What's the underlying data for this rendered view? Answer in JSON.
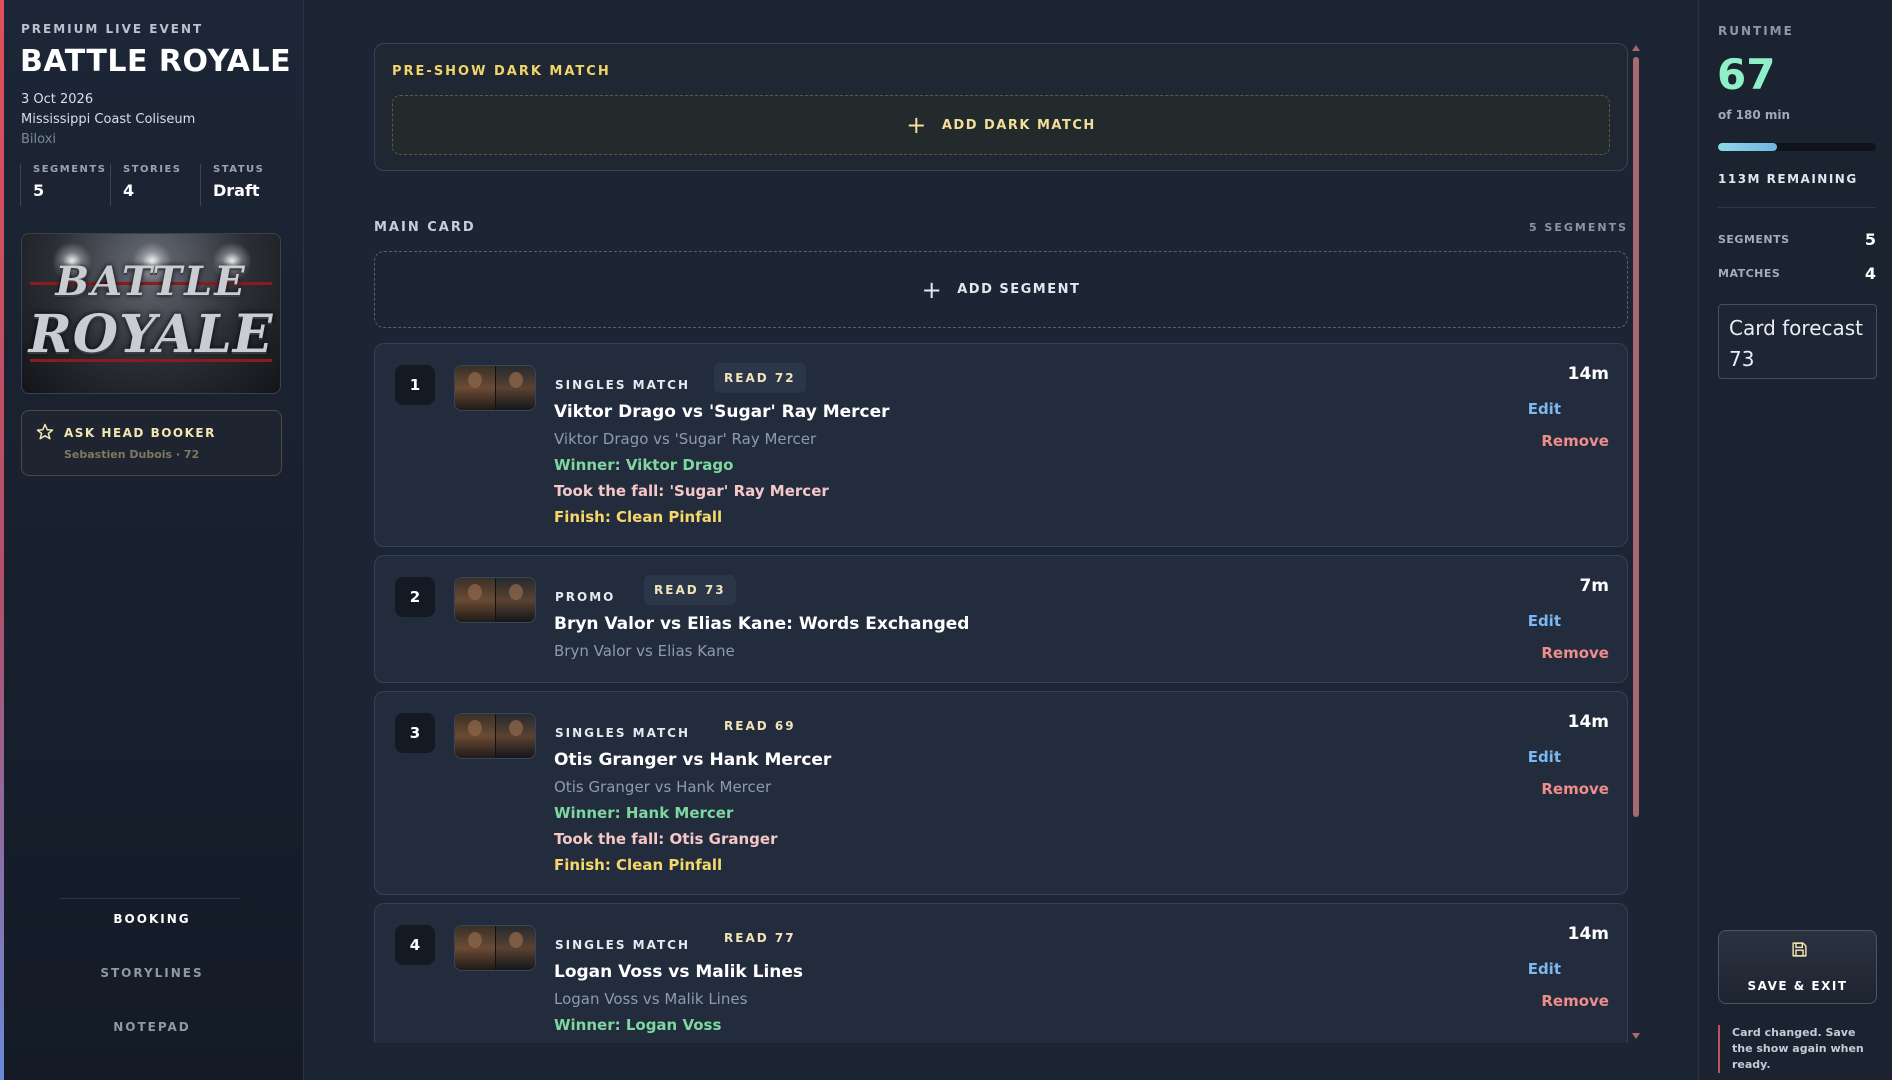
{
  "event": {
    "kicker": "PREMIUM LIVE EVENT",
    "title": "BATTLE ROYALE",
    "date": "3 Oct 2026",
    "venue": "Mississippi Coast Coliseum",
    "city": "Biloxi",
    "poster_text_line1": "BATTLE",
    "poster_text_line2": "ROYALE"
  },
  "stats": [
    {
      "label": "SEGMENTS",
      "value": "5"
    },
    {
      "label": "STORIES",
      "value": "4"
    },
    {
      "label": "STATUS",
      "value": "Draft"
    }
  ],
  "ask_booker": {
    "label": "ASK HEAD BOOKER",
    "sub": "Sebastien Dubois · 72"
  },
  "nav": {
    "booking": "BOOKING",
    "storylines": "STORYLINES",
    "notepad": "NOTEPAD"
  },
  "dark_match": {
    "title": "PRE-SHOW DARK MATCH",
    "add_label": "ADD DARK MATCH"
  },
  "main_card": {
    "label": "MAIN CARD",
    "count": "5 SEGMENTS",
    "add_label": "ADD SEGMENT"
  },
  "actions": {
    "edit": "Edit",
    "remove": "Remove"
  },
  "segments": [
    {
      "number": "1",
      "type": "SINGLES MATCH",
      "read": "READ 72",
      "duration": "14m",
      "title": "Viktor Drago vs 'Sugar' Ray Mercer",
      "sub": "Viktor Drago vs 'Sugar' Ray Mercer",
      "winner": "Winner: Viktor Drago",
      "fall": "Took the fall: 'Sugar' Ray Mercer",
      "finish": "Finish: Clean Pinfall"
    },
    {
      "number": "2",
      "type": "PROMO",
      "read": "READ 73",
      "duration": "7m",
      "title": "Bryn Valor vs Elias Kane: Words Exchanged",
      "sub": "Bryn Valor vs Elias Kane"
    },
    {
      "number": "3",
      "type": "SINGLES MATCH",
      "read": "READ 69",
      "duration": "14m",
      "title": "Otis Granger vs Hank Mercer",
      "sub": "Otis Granger vs Hank Mercer",
      "winner": "Winner: Hank Mercer",
      "fall": "Took the fall: Otis Granger",
      "finish": "Finish: Clean Pinfall"
    },
    {
      "number": "4",
      "type": "SINGLES MATCH",
      "read": "READ 77",
      "duration": "14m",
      "title": "Logan Voss vs Malik Lines",
      "sub": "Logan Voss vs Malik Lines",
      "winner": "Winner: Logan Voss"
    }
  ],
  "runtime": {
    "label": "RUNTIME",
    "value": "67",
    "of": "of 180 min",
    "progress_fraction": 0.372,
    "remaining": "113M REMAINING"
  },
  "summary": {
    "segments_label": "SEGMENTS",
    "segments_value": "5",
    "matches_label": "MATCHES",
    "matches_value": "4"
  },
  "forecast": {
    "label": "Card forecast",
    "value": "73"
  },
  "save": {
    "label": "SAVE & EXIT",
    "icon": "save-icon"
  },
  "notice": "Card changed. Save the show again when ready.",
  "colors": {
    "accent_gold": "#f2d56a",
    "runtime_green": "#8ff0c8",
    "edit_blue": "#7cb7f2",
    "remove_red": "#ef8d8d",
    "winner_green": "#7fd7a0"
  }
}
